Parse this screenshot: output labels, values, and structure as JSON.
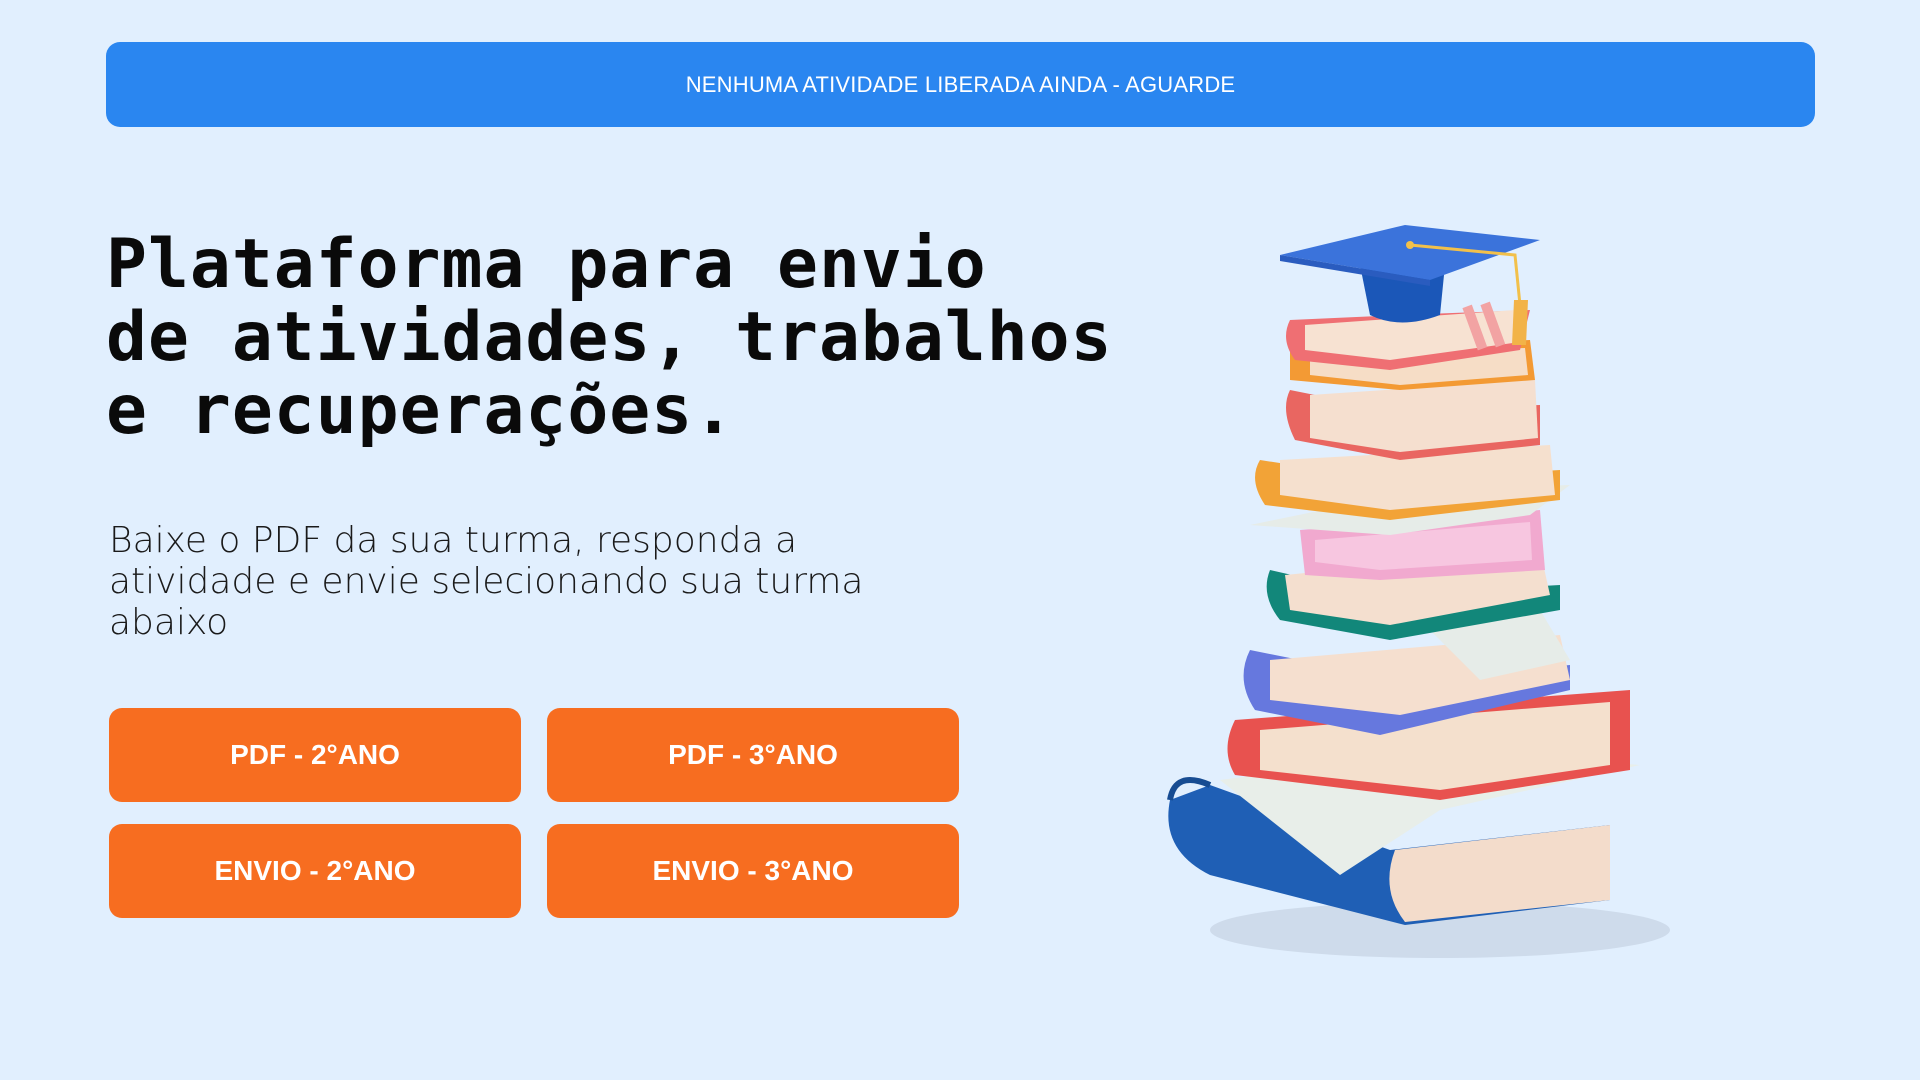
{
  "banner": {
    "text": "NENHUMA ATIVIDADE LIBERADA AINDA - AGUARDE"
  },
  "hero": {
    "title_lines": [
      "Plataforma para envio",
      "de atividades, trabalhos",
      "e recuperações."
    ],
    "description_lines": [
      "Baixe o PDF da sua turma, responda a",
      "atividade e envie selecionando sua turma",
      "abaixo"
    ]
  },
  "buttons": {
    "pdf_2": "PDF - 2°ANO",
    "pdf_3": "PDF - 3°ANO",
    "envio_2": "ENVIO - 2°ANO",
    "envio_3": "ENVIO - 3°ANO"
  },
  "colors": {
    "background": "#e1effe",
    "banner": "#2a86f0",
    "button": "#f76d20"
  },
  "illustration": {
    "icon": "stack-of-books-with-graduation-cap-icon"
  }
}
